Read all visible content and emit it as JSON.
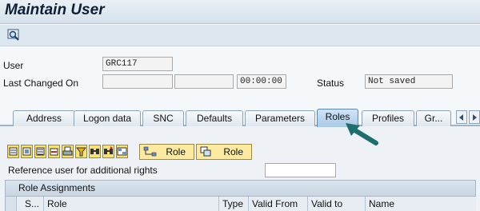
{
  "window": {
    "title": "Maintain User"
  },
  "toolbar": {
    "display_icon": "display-glasses-icon"
  },
  "form": {
    "user_label": "User",
    "user_value": "GRC117",
    "last_changed_label": "Last Changed On",
    "last_changed_date": "",
    "last_changed_by": "",
    "last_changed_time": "00:00:00",
    "status_label": "Status",
    "status_value": "Not saved"
  },
  "tabs": [
    "Address",
    "Logon data",
    "SNC",
    "Defaults",
    "Parameters",
    "Roles",
    "Profiles",
    "Gr..."
  ],
  "active_tab": "Roles",
  "roles_panel": {
    "role_button_1": "Role",
    "role_button_2": "Role",
    "reference_label": "Reference user for additional rights",
    "reference_value": "",
    "table_title": "Role Assignments",
    "columns": [
      "S...",
      "Role",
      "Type",
      "Valid From",
      "Valid to",
      "Name"
    ]
  },
  "colors": {
    "accent_arrow": "#1f6e6e",
    "button_yellow": "#f7e27a",
    "active_tab": "#b9d5ee"
  }
}
